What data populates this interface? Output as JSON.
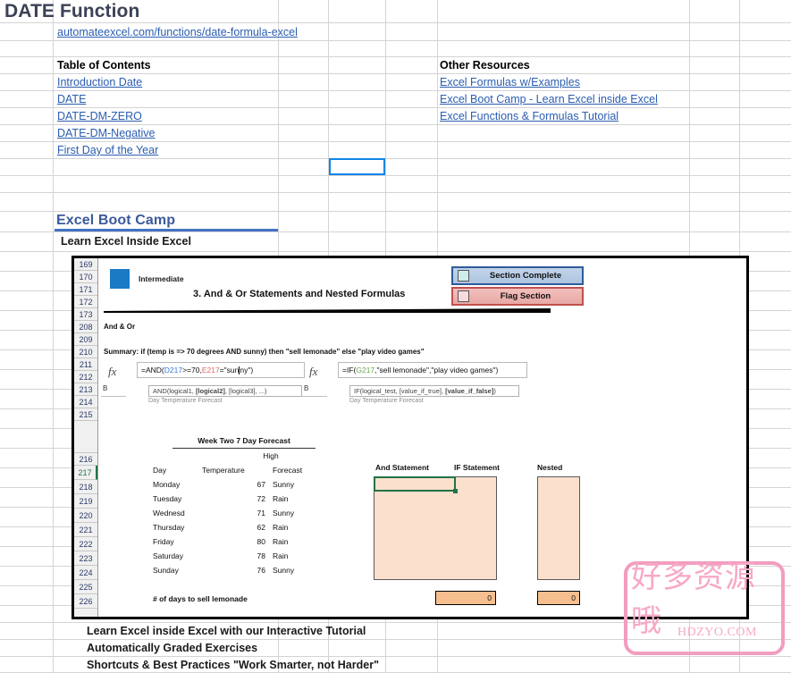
{
  "sheet": {
    "title": "DATE Function",
    "url_link": "automateexcel.com/functions/date-formula-excel",
    "toc_heading": "Table of Contents",
    "toc_links": [
      "Introduction Date",
      "DATE",
      "DATE-DM-ZERO",
      "DATE-DM-Negative",
      "First Day of the Year"
    ],
    "resources_heading": "Other Resources",
    "resources_links": [
      "Excel Formulas w/Examples",
      "Excel Boot Camp - Learn Excel inside Excel",
      "Excel Functions & Formulas Tutorial"
    ],
    "bootcamp_heading": "Excel Boot Camp",
    "bootcamp_sub": "Learn Excel Inside Excel",
    "bullets": [
      "Learn Excel inside Excel with our Interactive Tutorial",
      "Automatically Graded Exercises",
      "Shortcuts & Best Practices \"Work Smarter, not Harder\""
    ]
  },
  "embedded": {
    "level_label": "Intermediate",
    "lesson_title": "3. And & Or Statements and Nested Formulas",
    "section_label": "And & Or",
    "summary": "Summary: if (temp is => 70 degrees AND sunny) then \"sell lemonade\" else \"play video games\"",
    "row_numbers": [
      "169",
      "170",
      "171",
      "172",
      "173",
      "208",
      "209",
      "210",
      "211",
      "212",
      "213",
      "214",
      "215",
      "",
      "216",
      "217",
      "218",
      "219",
      "220",
      "221",
      "222",
      "223",
      "224",
      "225",
      "226"
    ],
    "active_row": "217",
    "legend": [
      {
        "label": "Section Complete",
        "checked": false
      },
      {
        "label": "Flag Section",
        "checked": false
      }
    ],
    "formulas": [
      {
        "cell_ref": "B",
        "fx": "fx",
        "parts": [
          {
            "text": "=AND(",
            "color": "black"
          },
          {
            "text": "D217",
            "color": "blue"
          },
          {
            "text": ">=70,",
            "color": "black"
          },
          {
            "text": "E217",
            "color": "red"
          },
          {
            "text": "=\"sunny\")",
            "color": "black"
          }
        ],
        "full_text": "=AND(D217>=70,E217=\"sunny\")",
        "tooltip": "AND(logical1, [logical2], [logical3], ...)",
        "tooltip_bold": "[logical2]",
        "ghost": "Day  Temperature  Forecast"
      },
      {
        "cell_ref": "B",
        "fx": "fx",
        "parts": [
          {
            "text": "=IF(",
            "color": "black"
          },
          {
            "text": "G217",
            "color": "green"
          },
          {
            "text": ",\"sell lemonade\",\"play video games\")",
            "color": "black"
          }
        ],
        "full_text": "=IF(G217,\"sell lemonade\",\"play video games\")",
        "tooltip": "IF(logical_test, [value_if_true], [value_if_false])",
        "tooltip_bold": "[value_if_false]",
        "ghost": "Day  Temperature  Forecast"
      }
    ],
    "forecast": {
      "title": "Week Two 7 Day Forecast",
      "high_label": "High",
      "columns": [
        "Day",
        "Temperature",
        "Forecast"
      ],
      "rows": [
        {
          "day": "Monday",
          "temp": "67",
          "forecast": "Sunny"
        },
        {
          "day": "Tuesday",
          "temp": "72",
          "forecast": "Rain"
        },
        {
          "day": "Wednesd",
          "temp": "71",
          "forecast": "Sunny"
        },
        {
          "day": "Thursday",
          "temp": "62",
          "forecast": "Rain"
        },
        {
          "day": "Friday",
          "temp": "80",
          "forecast": "Rain"
        },
        {
          "day": "Saturday",
          "temp": "78",
          "forecast": "Rain"
        },
        {
          "day": "Sunday",
          "temp": "76",
          "forecast": "Sunny"
        }
      ],
      "footer_label": "# of days to sell lemonade"
    },
    "statements": {
      "and_header": "And Statement",
      "if_header": "IF Statement",
      "nested_header": "Nested",
      "if_total": "0",
      "nested_total": "0"
    }
  },
  "watermark": {
    "text": "好多资源哦",
    "url": "HDZYO.COM"
  },
  "colors": {
    "link": "#2a5db0",
    "title": "#3b4256",
    "bootcamp": "#3b5a99",
    "accent_bar": "#4472c4",
    "selection": "#0f86e8",
    "excel_green": "#217346",
    "box_fill": "#fbe0cd",
    "total_fill": "#f7bf8f",
    "watermark": "#f7a8c6"
  }
}
